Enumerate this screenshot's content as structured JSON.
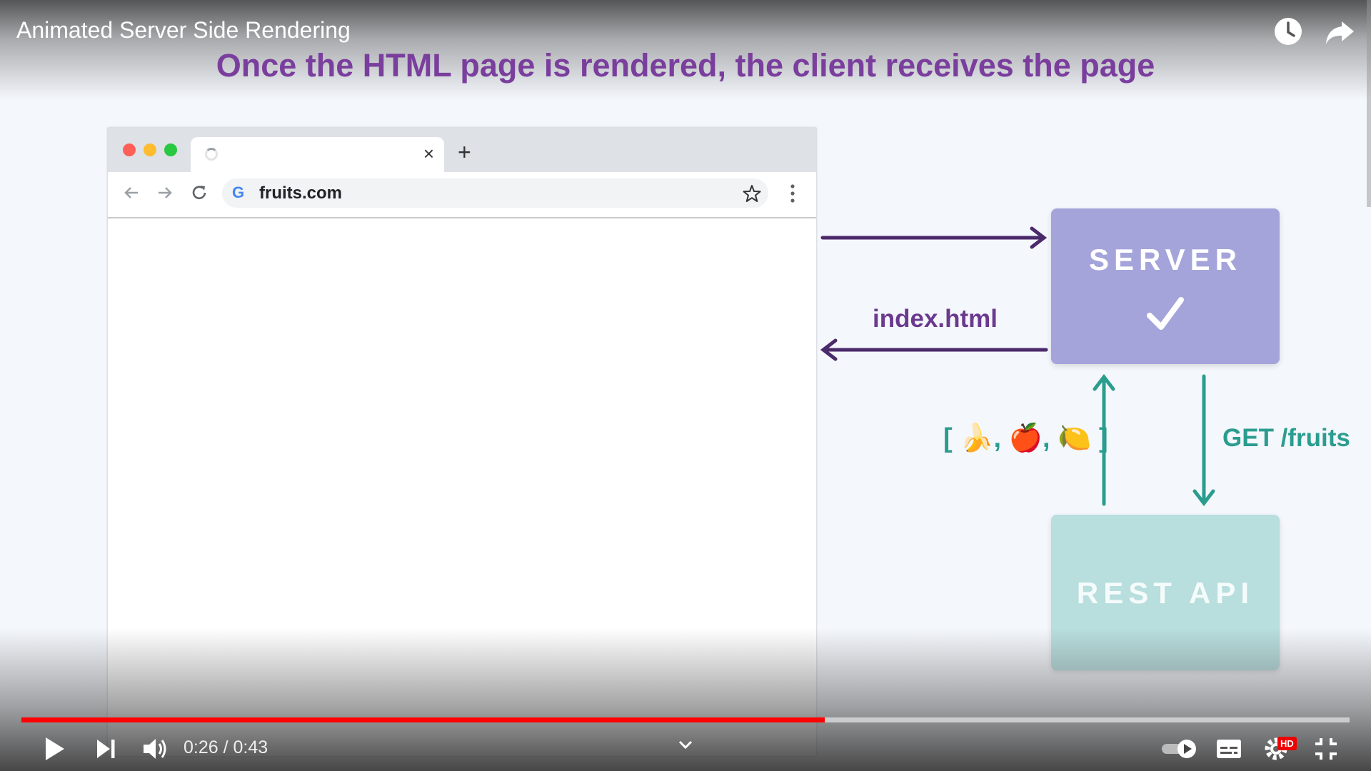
{
  "player": {
    "title": "Animated Server Side Rendering",
    "time_display": "0:26 / 0:43",
    "progress_fraction": 0.605,
    "hd_badge": "HD"
  },
  "slide": {
    "headline": "Once the HTML page is rendered, the client receives the page",
    "browser": {
      "url": "fruits.com",
      "tab_close": "×",
      "new_tab": "+",
      "search_logo": "G"
    },
    "server_label": "SERVER",
    "rest_label": "REST API",
    "response_label": "index.html",
    "request_label": "GET /fruits",
    "fruits_label": "[ 🍌, 🍎, 🍋 ]"
  },
  "colors": {
    "headline": "#7a3e9d",
    "server_box": "#a4a4db",
    "rest_box": "#b8dede",
    "purple_arrow": "#4b2a6b",
    "teal_arrow": "#2a9d8f",
    "progress": "#ff0000"
  },
  "icons": {
    "watch_later": "clock-icon",
    "share": "share-icon",
    "play": "play-icon",
    "next": "next-icon",
    "volume": "volume-icon",
    "autoplay": "autoplay-toggle-icon",
    "captions": "captions-icon",
    "settings": "gear-icon",
    "exit_fullscreen": "exit-fullscreen-icon"
  }
}
